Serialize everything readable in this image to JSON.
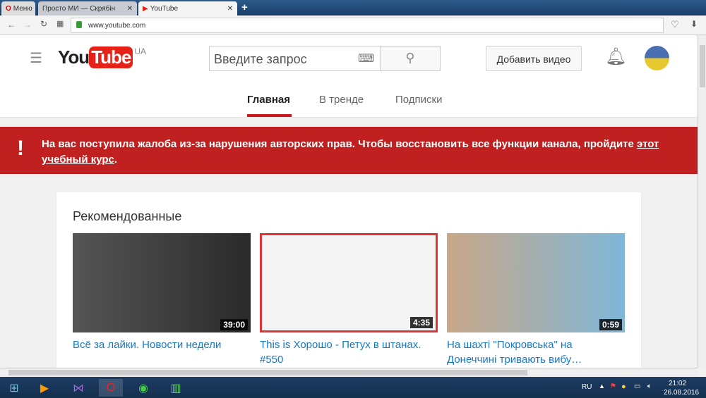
{
  "browser": {
    "menu_label": "Меню",
    "tabs": [
      {
        "title": "Просто МИ — Скрябін"
      },
      {
        "title": "YouTube"
      }
    ],
    "url": "www.youtube.com"
  },
  "header": {
    "logo_you": "You",
    "logo_tube": "Tube",
    "region": "UA",
    "search_placeholder": "Введите запрос",
    "upload_label": "Добавить видео"
  },
  "nav": {
    "tabs": [
      {
        "label": "Главная",
        "active": true
      },
      {
        "label": "В тренде"
      },
      {
        "label": "Подписки"
      }
    ]
  },
  "banner": {
    "icon": "!",
    "text": "На вас поступила жалоба из-за нарушения авторских прав. Чтобы восстановить все функции канала, пройдите ",
    "link": "этот учебный курс",
    "end": "."
  },
  "section": {
    "title": "Рекомендованные"
  },
  "videos": [
    {
      "title": "Всё за лайки. Новости недели",
      "duration": "39:00",
      "thumb_color": "#3a3a3a"
    },
    {
      "title": "This is Хорошо - Петух в штанах. #550",
      "duration": "4:35",
      "thumb_color": "#f4f4f4"
    },
    {
      "title": "На шахті \"Покровська\" на Донеччині тривають вибу…",
      "duration": "0:59",
      "thumb_color": "#b89a80"
    }
  ],
  "taskbar": {
    "lang": "RU",
    "time": "21:02",
    "date": "26.08.2016"
  },
  "colors": {
    "youtube_red": "#e62117",
    "banner_red": "#c0201f",
    "link_blue": "#167ac6"
  }
}
